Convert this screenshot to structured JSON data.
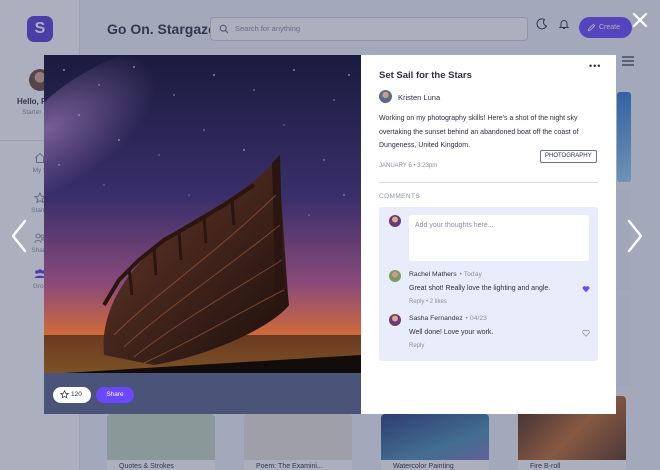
{
  "app": {
    "title": "Go On. Stargaze.",
    "search_placeholder": "Search for anything",
    "create_label": "Create",
    "logo_glyph": "S"
  },
  "sidebar": {
    "greeting": "Hello, R",
    "subtitle": "Starter",
    "items": [
      {
        "label": "My S",
        "icon": "home-icon"
      },
      {
        "label": "Starre",
        "icon": "star-icon"
      },
      {
        "label": "Share",
        "icon": "people-icon"
      },
      {
        "label": "Grou",
        "icon": "group-icon"
      }
    ]
  },
  "gallery": {
    "cards": [
      {
        "caption": "Quotes & Strokes",
        "color": "#c9d8c2"
      },
      {
        "caption": "Poem: The Examini...",
        "color": "#e8e4da"
      },
      {
        "caption": "Watercolor Painting",
        "color": "#3d4f9a"
      },
      {
        "caption": "Fire B-roll",
        "color": "#7a4a2a"
      }
    ]
  },
  "post": {
    "title": "Set Sail for the Stars",
    "author": "Kristen Luna",
    "body": "Working on my photography skills! Here’s a shot of the night sky overtaking the sunset behind an abandoned boat off the coast of Dungeness, United Kingdom.",
    "date": "JANUARY 6 • 3:23pm",
    "tag": "PHOTOGRAPHY",
    "likes": "120",
    "share_label": "Share"
  },
  "comments": {
    "heading": "COMMENTS",
    "input_placeholder": "Add your thoughts here...",
    "items": [
      {
        "author": "Rachel Mathers",
        "when": "• Today",
        "text": "Great shot! Really love the lighting and angle.",
        "reply_label": "Reply",
        "likes_label": "• 2 likes",
        "liked": true
      },
      {
        "author": "Sasha Fernandez",
        "when": "• 04/23",
        "text": "Well done! Love your work.",
        "reply_label": "Reply",
        "likes_label": "",
        "liked": false
      }
    ]
  },
  "colors": {
    "accent": "#6b48ff",
    "overlay": "#364064",
    "comment_bg": "#e9ecfa"
  }
}
